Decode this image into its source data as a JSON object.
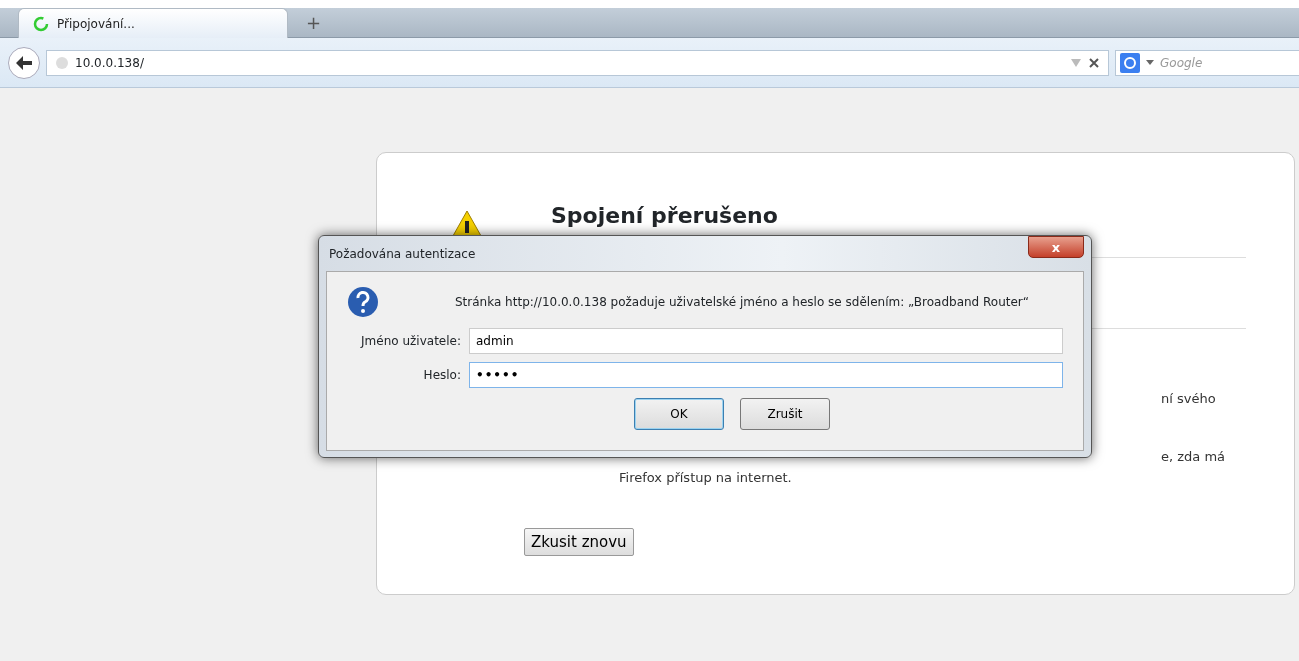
{
  "browser": {
    "tabs": [
      {
        "title": "Připojování...",
        "selected": true,
        "loading": true
      }
    ],
    "new_tab": "+",
    "address": "10.0.0.138/",
    "search": {
      "placeholder": "Google"
    }
  },
  "error_page": {
    "title": "Spojení přerušeno",
    "fragments": [
      "ní svého",
      "e, zda má",
      "Firefox přístup na internet."
    ],
    "retry_button": "Zkusit znovu"
  },
  "dialog": {
    "title": "Požadována autentizace",
    "close": "x",
    "message": "Stránka http://10.0.0.138 požaduje uživatelské jméno a heslo se sdělením: „Broadband Router“",
    "fields": [
      {
        "label": "Jméno uživatele:",
        "value": "admin",
        "kind": "text",
        "focused": false
      },
      {
        "label": "Heslo:",
        "value": "•••••",
        "kind": "password",
        "focused": true
      }
    ],
    "buttons": [
      {
        "label": "OK",
        "default": true
      },
      {
        "label": "Zrušit",
        "default": false
      }
    ]
  }
}
